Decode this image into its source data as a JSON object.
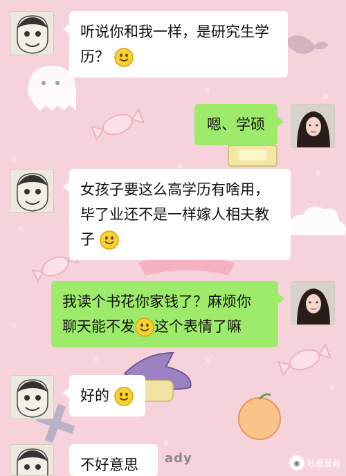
{
  "colors": {
    "wallpaper": "#f6d3db",
    "incoming_bubble": "#ffffff",
    "outgoing_bubble": "#9eea6a"
  },
  "messages": [
    {
      "side": "incoming",
      "line1": "听说你和我一样，是研究生学",
      "line2": "历？",
      "emoji": "smile-emoji"
    },
    {
      "side": "outgoing",
      "line1": "嗯、学硕"
    },
    {
      "side": "incoming",
      "line1": "女孩子要这么高学历有啥用，",
      "line2": "毕了业还不是一样嫁人相夫教",
      "line3": "子",
      "emoji": "smile-emoji"
    },
    {
      "side": "outgoing",
      "line1": "我读个书花你家钱了？麻烦你",
      "line2a": "聊天能不发",
      "line2b": "这个表情了嘛",
      "emoji": "smile-emoji"
    },
    {
      "side": "incoming",
      "line1": "好的",
      "emoji": "smile-emoji"
    },
    {
      "side": "incoming",
      "line1": "不好意思"
    }
  ],
  "watermark": {
    "text": "吐槽星君"
  },
  "wallpaper_text": "ady"
}
